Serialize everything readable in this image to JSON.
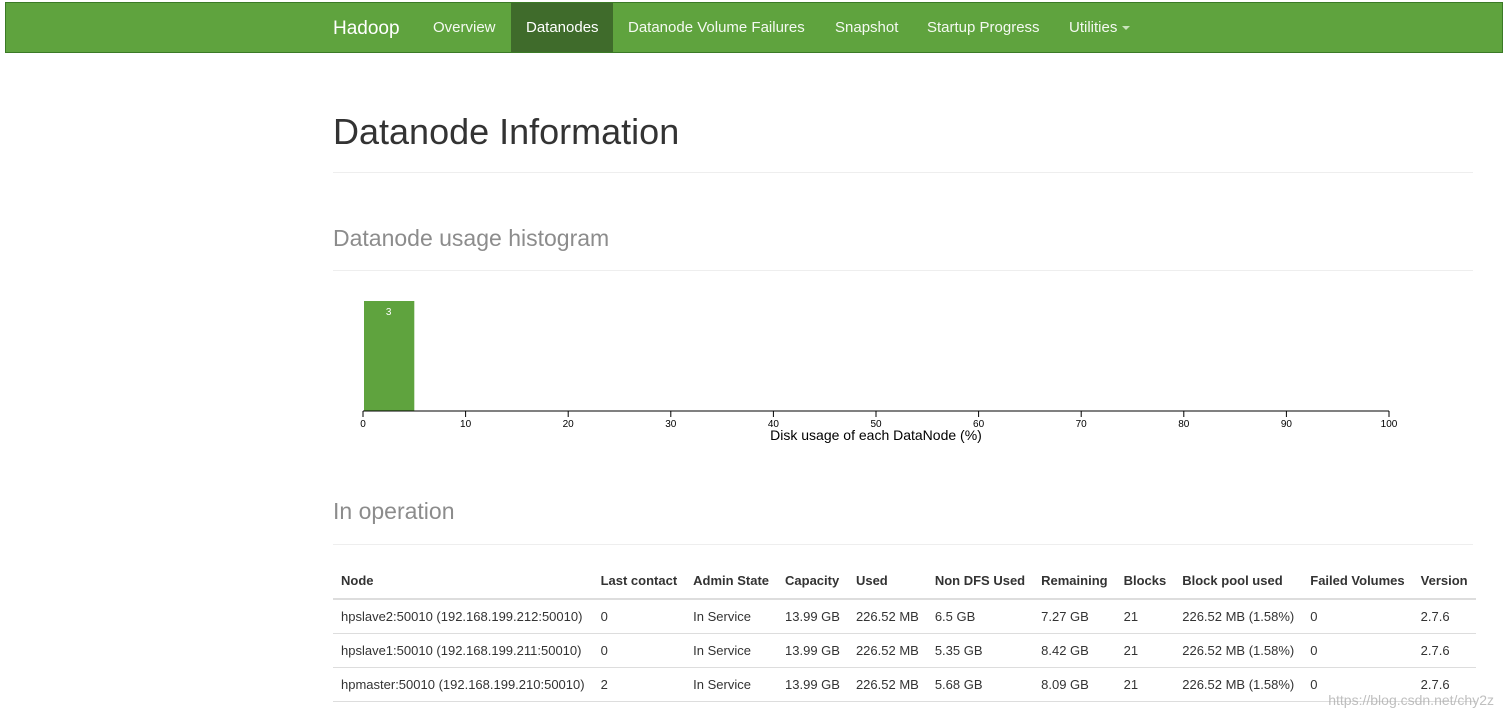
{
  "navbar": {
    "brand": "Hadoop",
    "items": [
      {
        "label": "Overview",
        "active": false
      },
      {
        "label": "Datanodes",
        "active": true
      },
      {
        "label": "Datanode Volume Failures",
        "active": false
      },
      {
        "label": "Snapshot",
        "active": false
      },
      {
        "label": "Startup Progress",
        "active": false
      },
      {
        "label": "Utilities",
        "active": false,
        "dropdown": true
      }
    ]
  },
  "page": {
    "title": "Datanode Information",
    "histogram_title": "Datanode usage histogram",
    "in_operation_title": "In operation"
  },
  "chart_data": {
    "type": "bar",
    "title": "",
    "xlabel": "Disk usage of each DataNode (%)",
    "ylabel": "",
    "xlim": [
      0,
      100
    ],
    "x_ticks": [
      "0",
      "10",
      "20",
      "30",
      "40",
      "50",
      "60",
      "70",
      "80",
      "90",
      "100"
    ],
    "bins": [
      {
        "start": 0,
        "end": 5,
        "count": 3
      }
    ],
    "bar_labels": [
      "3"
    ],
    "color": "#5fa33e"
  },
  "table": {
    "headers": [
      "Node",
      "Last contact",
      "Admin State",
      "Capacity",
      "Used",
      "Non DFS Used",
      "Remaining",
      "Blocks",
      "Block pool used",
      "Failed Volumes",
      "Version"
    ],
    "rows": [
      [
        "hpslave2:50010 (192.168.199.212:50010)",
        "0",
        "In Service",
        "13.99 GB",
        "226.52 MB",
        "6.5 GB",
        "7.27 GB",
        "21",
        "226.52 MB (1.58%)",
        "0",
        "2.7.6"
      ],
      [
        "hpslave1:50010 (192.168.199.211:50010)",
        "0",
        "In Service",
        "13.99 GB",
        "226.52 MB",
        "5.35 GB",
        "8.42 GB",
        "21",
        "226.52 MB (1.58%)",
        "0",
        "2.7.6"
      ],
      [
        "hpmaster:50010 (192.168.199.210:50010)",
        "2",
        "In Service",
        "13.99 GB",
        "226.52 MB",
        "5.68 GB",
        "8.09 GB",
        "21",
        "226.52 MB (1.58%)",
        "0",
        "2.7.6"
      ]
    ]
  },
  "watermark": "https://blog.csdn.net/chy2z"
}
